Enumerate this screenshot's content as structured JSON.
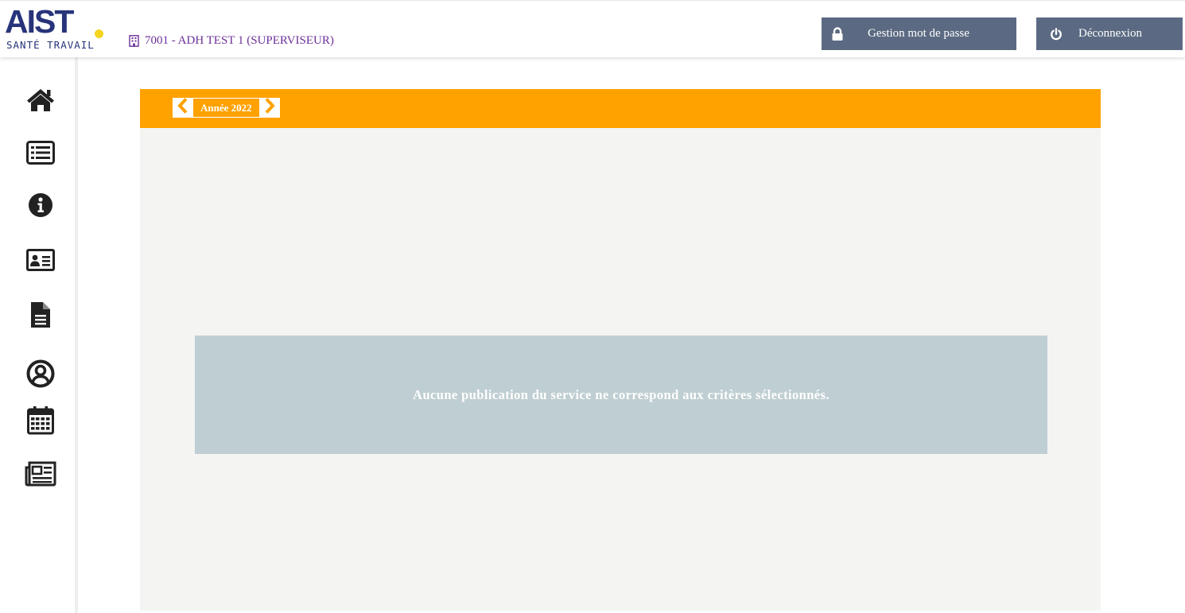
{
  "logo": {
    "main": "AIST",
    "sub": "SANTÉ TRAVAIL",
    "primary_color": "#27347a",
    "dot_color": "#f5d41f"
  },
  "header": {
    "account_icon": "building-icon",
    "account_label": "7001 - ADH TEST 1 (SUPERVISEUR)",
    "password_button": {
      "icon": "lock-icon",
      "label": "Gestion mot de passe"
    },
    "logout_button": {
      "icon": "power-icon",
      "label": "Déconnexion"
    },
    "button_color": "#5b6a82"
  },
  "sidebar": {
    "items": [
      {
        "icon": "home-icon"
      },
      {
        "icon": "list-icon"
      },
      {
        "icon": "info-icon"
      },
      {
        "icon": "id-card-icon"
      },
      {
        "icon": "document-icon"
      },
      {
        "icon": "user-circle-icon"
      },
      {
        "icon": "calendar-icon"
      },
      {
        "icon": "newspaper-icon"
      }
    ]
  },
  "main": {
    "year_bar_color": "#ffa200",
    "prev_icon": "chevron-left-icon",
    "next_icon": "chevron-right-icon",
    "year_label": "Année 2022",
    "empty_message": "Aucune publication du service ne correspond aux critères sélectionnés.",
    "empty_box_color": "#bfced2"
  }
}
